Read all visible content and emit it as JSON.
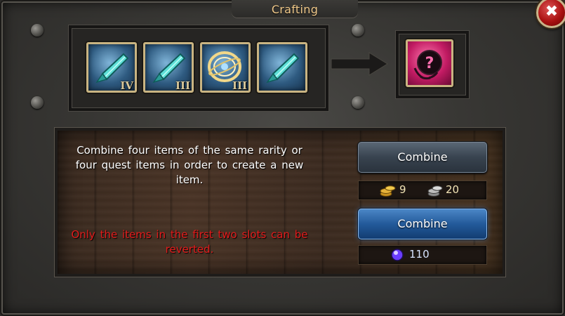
{
  "window": {
    "title": "Crafting",
    "close_symbol": "✖"
  },
  "ingredients": [
    {
      "icon": "spear-tip-icon",
      "tier": "IV"
    },
    {
      "icon": "spear-tip-icon",
      "tier": "III"
    },
    {
      "icon": "ring-orb-icon",
      "tier": "III"
    },
    {
      "icon": "spear-tip-icon",
      "tier": ""
    }
  ],
  "result": {
    "icon": "mystery-item-icon"
  },
  "info": {
    "description": "Combine four items of the same rarity or four quest items in order to create a new item.",
    "warning": "Only the items in the first two slots can be reverted."
  },
  "actions": {
    "combine_gold": {
      "label": "Combine",
      "costs": [
        {
          "icon": "gold-coins-icon",
          "value": "9"
        },
        {
          "icon": "silver-coins-icon",
          "value": "20"
        }
      ]
    },
    "combine_gem": {
      "label": "Combine",
      "costs": [
        {
          "icon": "purple-gem-icon",
          "value": "110"
        }
      ]
    }
  },
  "colors": {
    "title": "#f0c98a",
    "warning": "#e31b1b",
    "slot_border": "#c9b482",
    "premium_button": "#235a9a"
  }
}
